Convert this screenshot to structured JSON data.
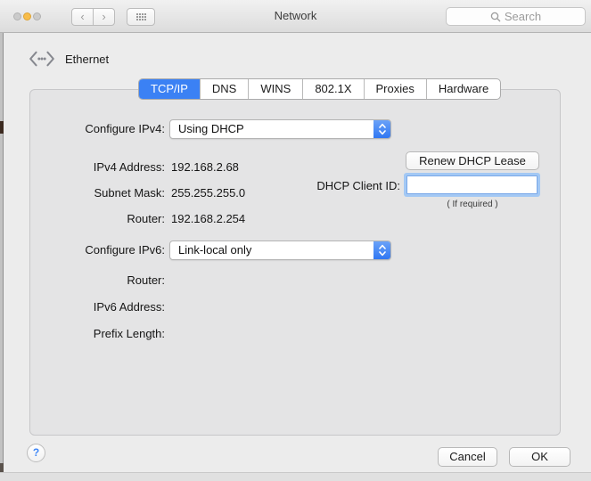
{
  "titlebar": {
    "title": "Network",
    "back_icon": "‹",
    "forward_icon": "›",
    "search_placeholder": "Search"
  },
  "connection": {
    "name": "Ethernet"
  },
  "tabs": {
    "items": [
      {
        "label": "TCP/IP",
        "selected": true
      },
      {
        "label": "DNS",
        "selected": false
      },
      {
        "label": "WINS",
        "selected": false
      },
      {
        "label": "802.1X",
        "selected": false
      },
      {
        "label": "Proxies",
        "selected": false
      },
      {
        "label": "Hardware",
        "selected": false
      }
    ]
  },
  "ipv4": {
    "configure_label": "Configure IPv4:",
    "configure_value": "Using DHCP",
    "address_label": "IPv4 Address:",
    "address_value": "192.168.2.68",
    "subnet_label": "Subnet Mask:",
    "subnet_value": "255.255.255.0",
    "router_label": "Router:",
    "router_value": "192.168.2.254"
  },
  "dhcp": {
    "renew_button": "Renew DHCP Lease",
    "client_id_label": "DHCP Client ID:",
    "client_id_value": "",
    "caption": "( If required )"
  },
  "ipv6": {
    "configure_label": "Configure IPv6:",
    "configure_value": "Link-local only",
    "router_label": "Router:",
    "router_value": "",
    "address_label": "IPv6 Address:",
    "address_value": "",
    "prefix_label": "Prefix Length:",
    "prefix_value": ""
  },
  "footer": {
    "help": "?",
    "cancel": "Cancel",
    "ok": "OK"
  },
  "colors": {
    "accent_blue": "#3b81f4",
    "focus_ring": "#a3c8f4",
    "titlebar_gray": "#e6e6e6"
  }
}
